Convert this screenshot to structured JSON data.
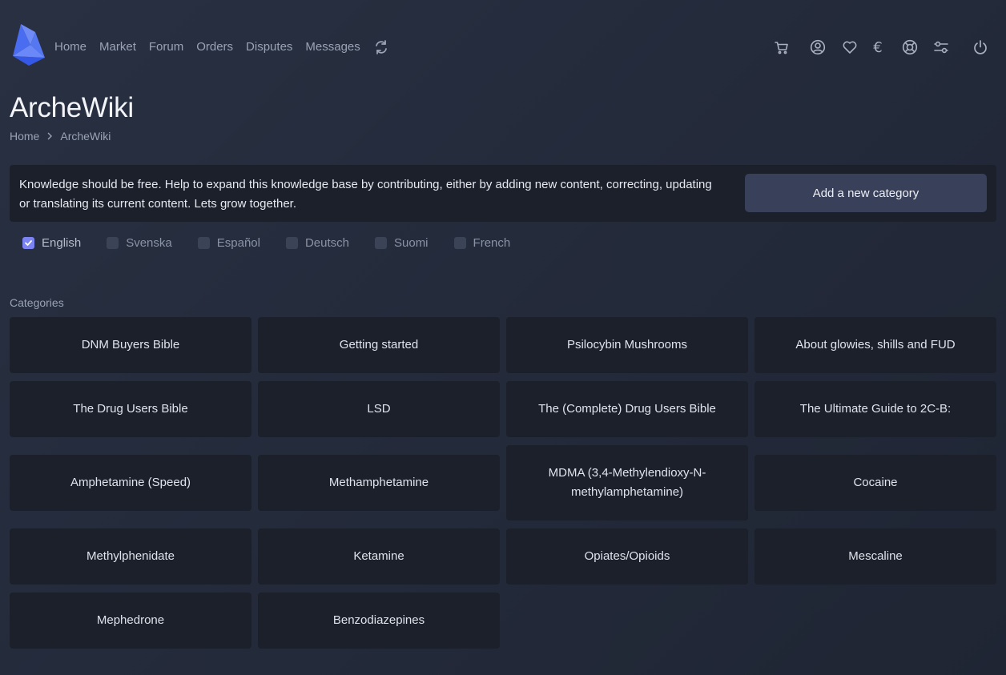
{
  "nav": {
    "items": [
      "Home",
      "Market",
      "Forum",
      "Orders",
      "Disputes",
      "Messages"
    ]
  },
  "icons": {
    "logo": "arche-logo",
    "refresh": "refresh-icon",
    "right": [
      "cart-icon",
      "user-icon",
      "heart-icon",
      "euro-icon",
      "lifebuoy-icon",
      "sliders-icon",
      "power-icon"
    ]
  },
  "currency_symbol": "€",
  "page": {
    "title": "ArcheWiki",
    "breadcrumb": [
      "Home",
      "ArcheWiki"
    ]
  },
  "info": {
    "text": "Knowledge should be free. Help to expand this knowledge base by contributing, either by adding new content, correcting, updating or translating its current content. Lets grow together.",
    "button": "Add a new category"
  },
  "languages": [
    {
      "label": "English",
      "checked": true
    },
    {
      "label": "Svenska",
      "checked": false
    },
    {
      "label": "Español",
      "checked": false
    },
    {
      "label": "Deutsch",
      "checked": false
    },
    {
      "label": "Suomi",
      "checked": false
    },
    {
      "label": "French",
      "checked": false
    }
  ],
  "categories_label": "Categories",
  "categories": [
    "DNM Buyers Bible",
    "Getting started",
    "Psilocybin Mushrooms",
    "About glowies, shills and FUD",
    "The Drug Users Bible",
    "LSD",
    "The (Complete) Drug Users Bible",
    "The Ultimate Guide to 2C-B:",
    "Amphetamine (Speed)",
    "Methamphetamine",
    "MDMA (3,4-Methylendioxy-N-methylamphetamine)",
    "Cocaine",
    "Methylphenidate",
    "Ketamine",
    "Opiates/Opioids",
    "Mescaline",
    "Mephedrone",
    "Benzodiazepines"
  ],
  "colors": {
    "accent": "#7b84f2",
    "card_bg": "#1b202b",
    "button_bg": "#38405a"
  }
}
